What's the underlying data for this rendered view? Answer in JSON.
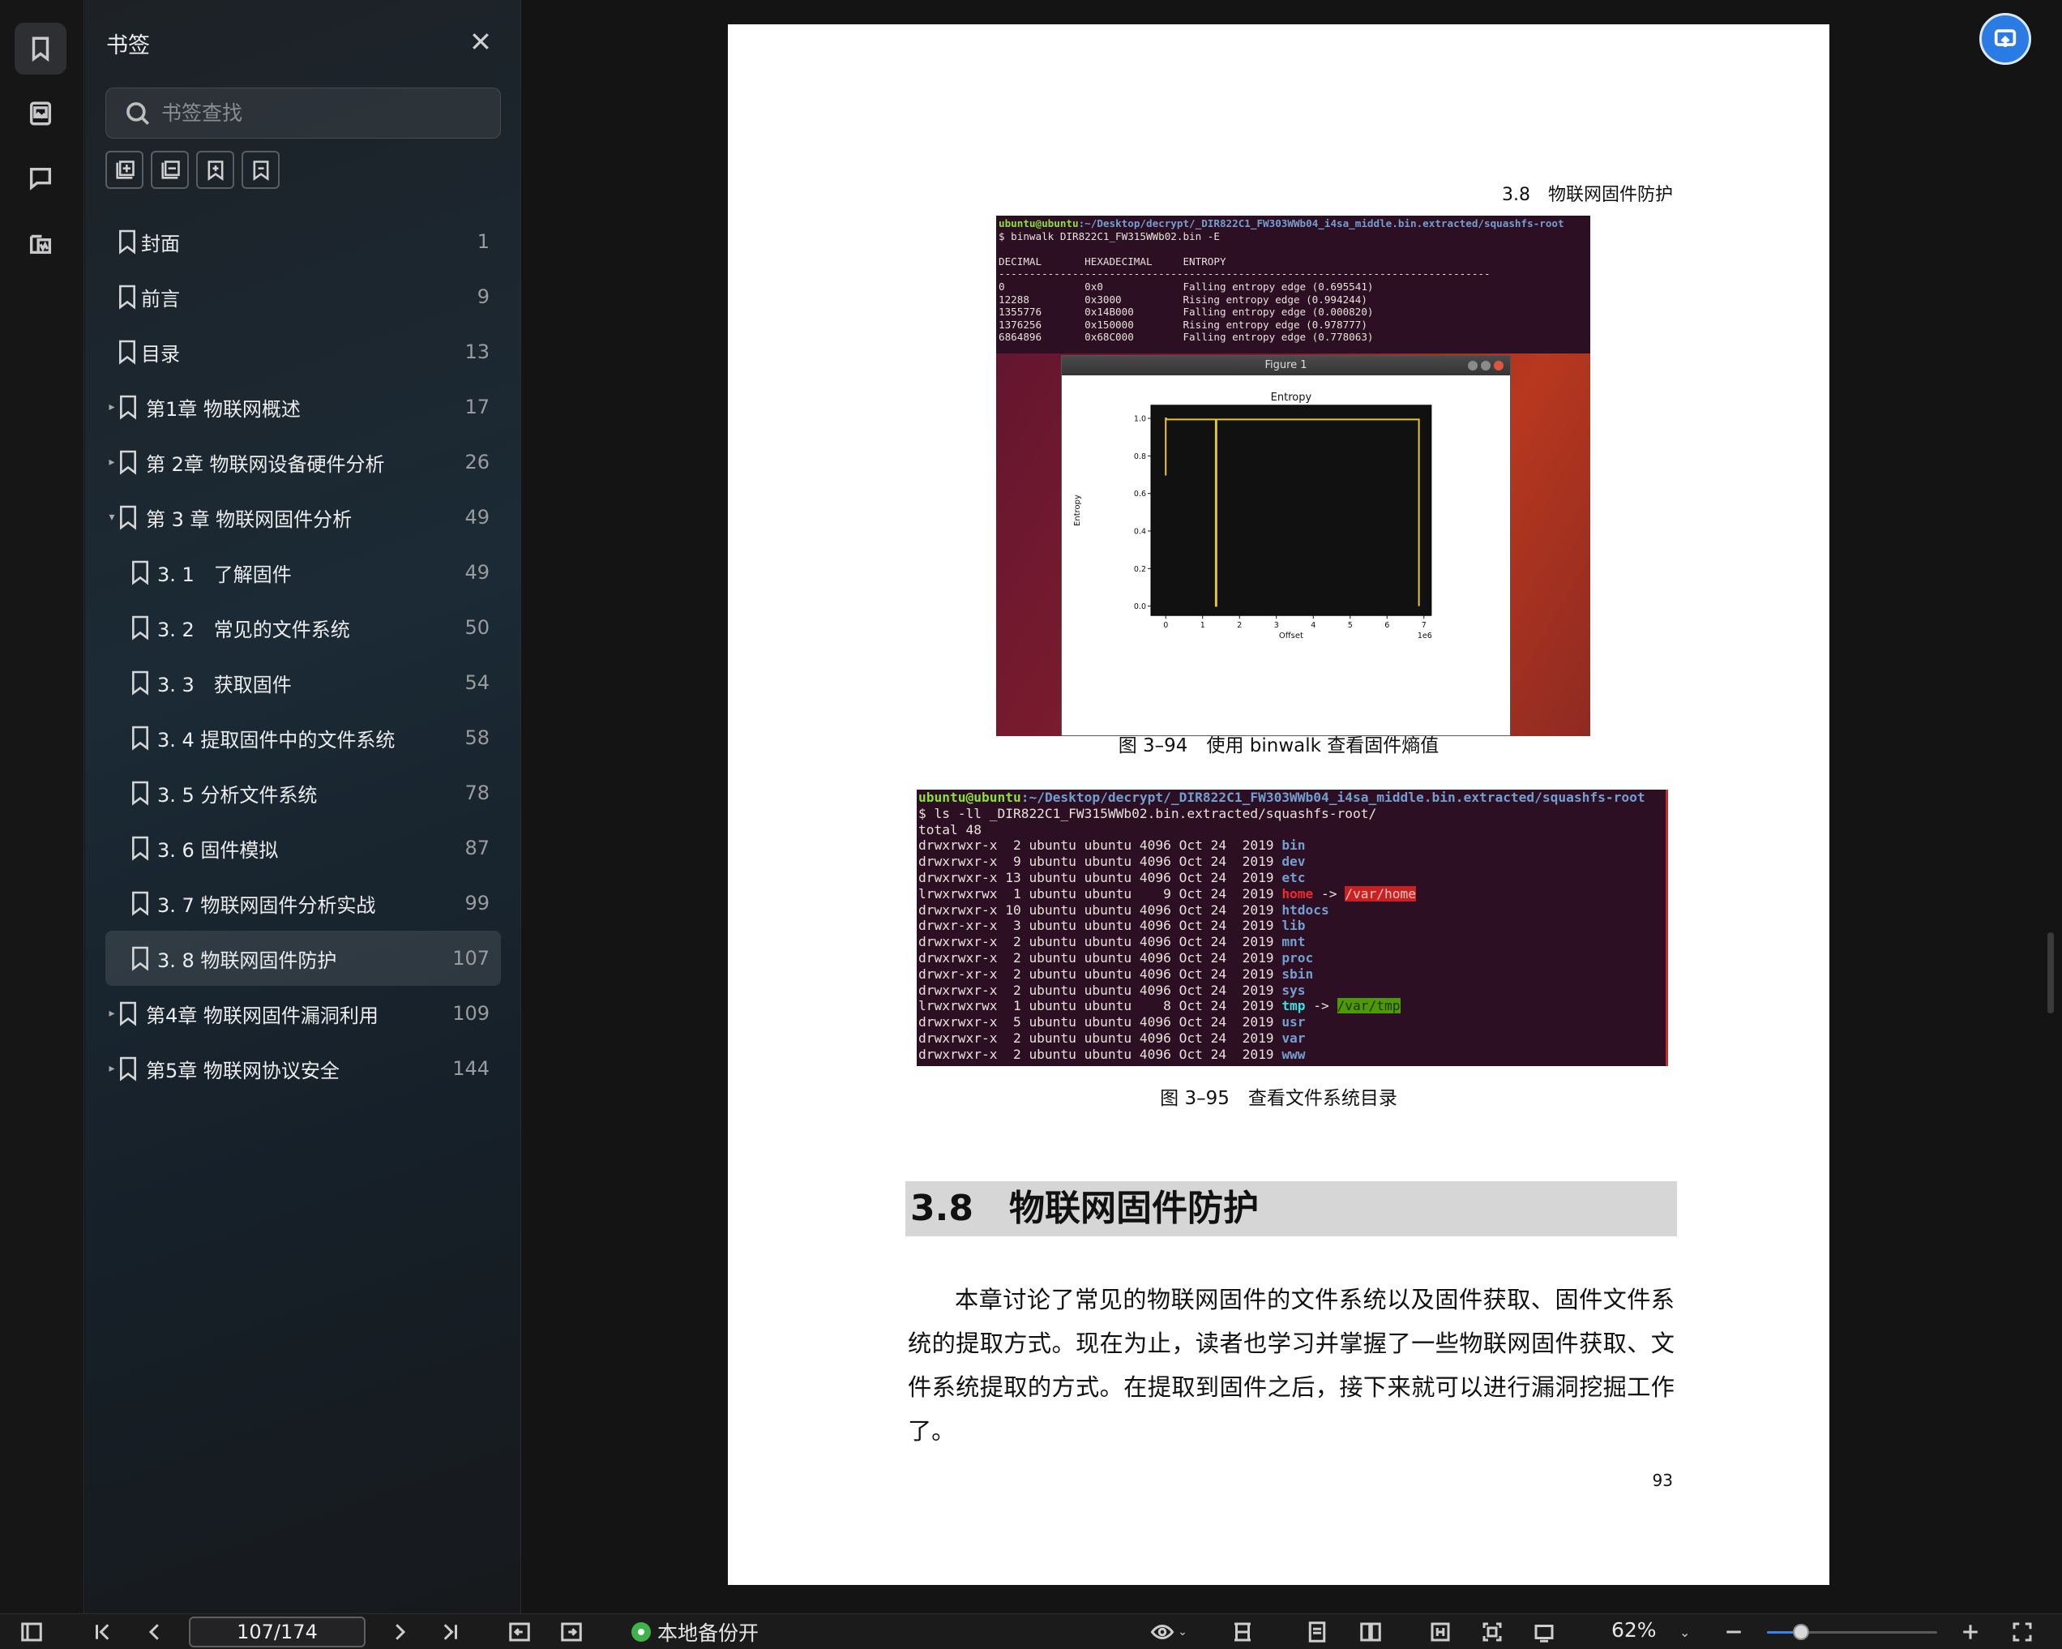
{
  "sidebar_panel": {
    "title": "书签",
    "search_placeholder": "书签查找",
    "bookmarks": [
      {
        "label": "封面",
        "page": "1",
        "level": 0,
        "arrow": ""
      },
      {
        "label": "前言",
        "page": "9",
        "level": 0,
        "arrow": ""
      },
      {
        "label": "目录",
        "page": "13",
        "level": 0,
        "arrow": ""
      },
      {
        "label": "第1章 物联网概述",
        "page": "17",
        "level": 0,
        "arrow": "▸"
      },
      {
        "label": "第 2章 物联网设备硬件分析",
        "page": "26",
        "level": 0,
        "arrow": "▸"
      },
      {
        "label": "第 3 章 物联网固件分析",
        "page": "49",
        "level": 0,
        "arrow": "▾"
      },
      {
        "label": "3. 1　了解固件",
        "page": "49",
        "level": 1,
        "arrow": ""
      },
      {
        "label": "3. 2　常见的文件系统",
        "page": "50",
        "level": 1,
        "arrow": ""
      },
      {
        "label": "3. 3　获取固件",
        "page": "54",
        "level": 1,
        "arrow": ""
      },
      {
        "label": "3. 4 提取固件中的文件系统",
        "page": "58",
        "level": 1,
        "arrow": ""
      },
      {
        "label": "3. 5 分析文件系统",
        "page": "78",
        "level": 1,
        "arrow": ""
      },
      {
        "label": "3. 6 固件模拟",
        "page": "87",
        "level": 1,
        "arrow": ""
      },
      {
        "label": "3. 7 物联网固件分析实战",
        "page": "99",
        "level": 1,
        "arrow": ""
      },
      {
        "label": "3. 8 物联网固件防护",
        "page": "107",
        "level": 1,
        "arrow": "",
        "selected": true
      },
      {
        "label": "第4章 物联网固件漏洞利用",
        "page": "109",
        "level": 0,
        "arrow": "▸"
      },
      {
        "label": "第5章 物联网协议安全",
        "page": "144",
        "level": 0,
        "arrow": "▸"
      }
    ]
  },
  "document": {
    "running_head": "3.8　物联网固件防护",
    "figure1": {
      "prompt_user": "ubuntu@ubuntu",
      "prompt_path": ":~/Desktop/decrypt/_DIR822C1_FW303WWb04_i4sa_middle.bin.extracted/squashfs-root",
      "command": "$ binwalk DIR822C1_FW315WWb02.bin -E",
      "header": "DECIMAL       HEXADECIMAL     ENTROPY",
      "rule": "--------------------------------------------------------------------------------",
      "rows": [
        "0             0x0             Falling entropy edge (0.695541)",
        "12288         0x3000          Rising entropy edge (0.994244)",
        "1355776       0x14B000        Falling entropy edge (0.000820)",
        "1376256       0x150000        Rising entropy edge (0.978777)",
        "6864896       0x68C000        Falling entropy edge (0.778063)"
      ],
      "window_title": "Figure 1",
      "caption": "图 3–94　使用 binwalk 查看固件熵值"
    },
    "chart_data": {
      "type": "line",
      "title": "Entropy",
      "xlabel": "Offset",
      "ylabel": "Entropy",
      "x_offset_label": "1e6",
      "xlim": [
        -0.4,
        7.2
      ],
      "ylim": [
        -0.05,
        1.07
      ],
      "x_ticks": [
        "0",
        "1",
        "2",
        "3",
        "4",
        "5",
        "6",
        "7"
      ],
      "y_ticks": [
        "0.0",
        "0.2",
        "0.4",
        "0.6",
        "0.8",
        "1.0"
      ],
      "series": [
        {
          "x": [
            0,
            0,
            0.012,
            0.012,
            1.356,
            1.356,
            1.376,
            1.376,
            6.865,
            6.865
          ],
          "y": [
            0.695541,
            1.0,
            1.0,
            0.994244,
            0.994244,
            0.00082,
            0.00082,
            0.994,
            0.994,
            0.0
          ],
          "color": "#e8c43a"
        }
      ],
      "background": "#111111"
    },
    "figure2": {
      "prompt_user": "ubuntu@ubuntu",
      "prompt_path": ":~/Desktop/decrypt/_DIR822C1_FW303WWb04_i4sa_middle.bin.extracted/squashfs-root",
      "command": "$ ls -ll _DIR822C1_FW315WWb02.bin.extracted/squashfs-root/",
      "total": "total 48",
      "entries": [
        {
          "meta": "drwxrwxr-x  2 ubuntu ubuntu 4096 Oct 24  2019 ",
          "name": "bin",
          "kind": "dir"
        },
        {
          "meta": "drwxrwxr-x  9 ubuntu ubuntu 4096 Oct 24  2019 ",
          "name": "dev",
          "kind": "dir"
        },
        {
          "meta": "drwxrwxr-x 13 ubuntu ubuntu 4096 Oct 24  2019 ",
          "name": "etc",
          "kind": "dir"
        },
        {
          "meta": "lrwxrwxrwx  1 ubuntu ubuntu    9 Oct 24  2019 ",
          "name": "home",
          "kind": "brokenlink",
          "target": "/var/home"
        },
        {
          "meta": "drwxrwxr-x 10 ubuntu ubuntu 4096 Oct 24  2019 ",
          "name": "htdocs",
          "kind": "dir"
        },
        {
          "meta": "drwxr-xr-x  3 ubuntu ubuntu 4096 Oct 24  2019 ",
          "name": "lib",
          "kind": "dir"
        },
        {
          "meta": "drwxrwxr-x  2 ubuntu ubuntu 4096 Oct 24  2019 ",
          "name": "mnt",
          "kind": "dir"
        },
        {
          "meta": "drwxrwxr-x  2 ubuntu ubuntu 4096 Oct 24  2019 ",
          "name": "proc",
          "kind": "dir"
        },
        {
          "meta": "drwxr-xr-x  2 ubuntu ubuntu 4096 Oct 24  2019 ",
          "name": "sbin",
          "kind": "dir"
        },
        {
          "meta": "drwxrwxr-x  2 ubuntu ubuntu 4096 Oct 24  2019 ",
          "name": "sys",
          "kind": "dir"
        },
        {
          "meta": "lrwxrwxrwx  1 ubuntu ubuntu    8 Oct 24  2019 ",
          "name": "tmp",
          "kind": "tmplink",
          "target": "/var/tmp"
        },
        {
          "meta": "drwxrwxr-x  5 ubuntu ubuntu 4096 Oct 24  2019 ",
          "name": "usr",
          "kind": "dir"
        },
        {
          "meta": "drwxrwxr-x  2 ubuntu ubuntu 4096 Oct 24  2019 ",
          "name": "var",
          "kind": "dir"
        },
        {
          "meta": "drwxrwxr-x  2 ubuntu ubuntu 4096 Oct 24  2019 ",
          "name": "www",
          "kind": "dir"
        }
      ],
      "caption": "图 3–95　查看文件系统目录"
    },
    "section_heading": "3.8　物联网固件防护",
    "paragraph": "本章讨论了常见的物联网固件的文件系统以及固件获取、固件文件系统的提取方式。现在为止，读者也学习并掌握了一些物联网固件获取、文件系统提取的方式。在提取到固件之后，接下来就可以进行漏洞挖掘工作了。",
    "page_number": "93"
  },
  "bottom_bar": {
    "page_indicator": "107/174",
    "backup_status": "本地备份开",
    "zoom": "62%",
    "zoom_fraction": 0.2
  },
  "colors": {
    "accent": "#3b82f0",
    "backup_green": "#3fb24a",
    "panel_bg": "#1b2a35"
  }
}
